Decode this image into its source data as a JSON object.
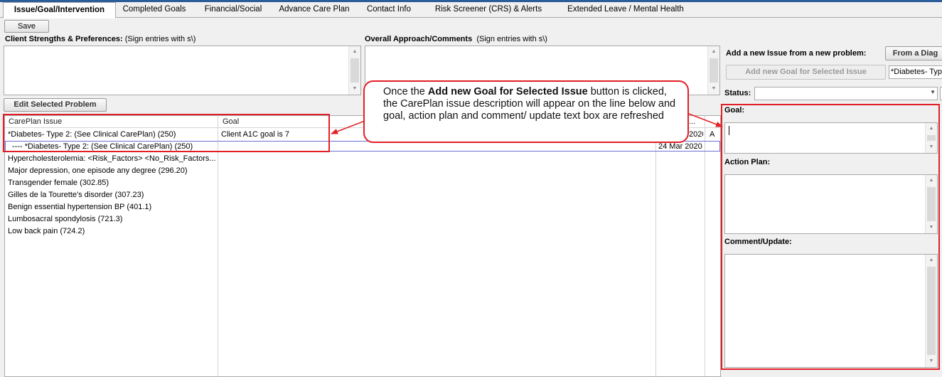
{
  "tabs": [
    {
      "label": "Issue/Goal/Intervention"
    },
    {
      "label": "Completed Goals"
    },
    {
      "label": "Financial/Social"
    },
    {
      "label": "Advance Care Plan"
    },
    {
      "label": "Contact Info"
    },
    {
      "label": "Risk Screener (CRS) & Alerts"
    },
    {
      "label": "Extended Leave / Mental Health"
    }
  ],
  "toolbar": {
    "save_label": "Save"
  },
  "strengths": {
    "label": "Client Strengths &  Preferences:",
    "hint": "(Sign entries with s\\)"
  },
  "approach": {
    "label": "Overall Approach/Comments",
    "hint": "(Sign entries with s\\)"
  },
  "edit_problem_label": "Edit Selected Problem",
  "grid": {
    "headers": {
      "issue": "CarePlan Issue",
      "goal": "Goal",
      "date": "...",
      "status": ""
    },
    "rows": [
      {
        "issue": "*Diabetes- Type 2: (See Clinical CarePlan) (250)",
        "goal": "Client A1C goal is 7",
        "date": "2020",
        "status": "A"
      },
      {
        "issue": "---- *Diabetes- Type 2: (See Clinical CarePlan) (250)",
        "goal": "",
        "date": "24 Mar 2020",
        "status": ""
      },
      {
        "issue": "Hypercholesterolemia: <Risk_Factors> <No_Risk_Factors...",
        "goal": "",
        "date": "",
        "status": ""
      },
      {
        "issue": "Major depression, one episode any degree (296.20)",
        "goal": "",
        "date": "",
        "status": ""
      },
      {
        "issue": "Transgender female (302.85)",
        "goal": "",
        "date": "",
        "status": ""
      },
      {
        "issue": "Gilles de la Tourette's disorder (307.23)",
        "goal": "",
        "date": "",
        "status": ""
      },
      {
        "issue": "Benign essential hypertension BP (401.1)",
        "goal": "",
        "date": "",
        "status": ""
      },
      {
        "issue": "Lumbosacral spondylosis (721.3)",
        "goal": "",
        "date": "",
        "status": ""
      },
      {
        "issue": "Low back pain (724.2)",
        "goal": "",
        "date": "",
        "status": ""
      }
    ]
  },
  "callout": {
    "pre": "Once the ",
    "bold": "Add new Goal for Selected Issue",
    "post": " button is clicked, the CarePlan issue description will appear on the line below and goal, action plan and comment/ update text box are refreshed"
  },
  "right": {
    "add_issue_label": "Add a new Issue from a new problem:",
    "from_diag_label": "From a Diag",
    "add_goal_label": "Add new Goal for Selected Issue",
    "issue_combo_value": "*Diabetes- Typ",
    "status_label": "Status:",
    "status_value": "",
    "goal_label": "Goal:",
    "goal_value": "",
    "action_plan_label": "Action Plan:",
    "action_plan_value": "",
    "comment_label": "Comment/Update:",
    "comment_value": ""
  },
  "colors": {
    "annotation": "#e21f26",
    "selection": "#6f6fd8",
    "accent": "#2a5d9a"
  }
}
